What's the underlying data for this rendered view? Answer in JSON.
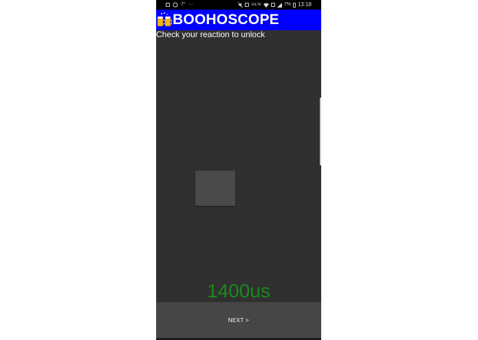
{
  "status_bar": {
    "notification_icons": [
      "image-icon",
      "whatsapp-icon",
      "weather-icon",
      "more-icon"
    ],
    "temperature": "7°",
    "more": "···",
    "network_label": "VoLTE",
    "battery_percent": "7%",
    "time": "13:18"
  },
  "app_bar": {
    "title": "BOOHOSCOPE",
    "logo_icon": "beer-mugs-icon",
    "background_color": "#0000ff"
  },
  "content": {
    "instruction": "Check your reaction to unlock",
    "reaction_time": "1400us",
    "reaction_time_color": "#1a8a1a"
  },
  "footer": {
    "next_label": "NEXT >"
  }
}
